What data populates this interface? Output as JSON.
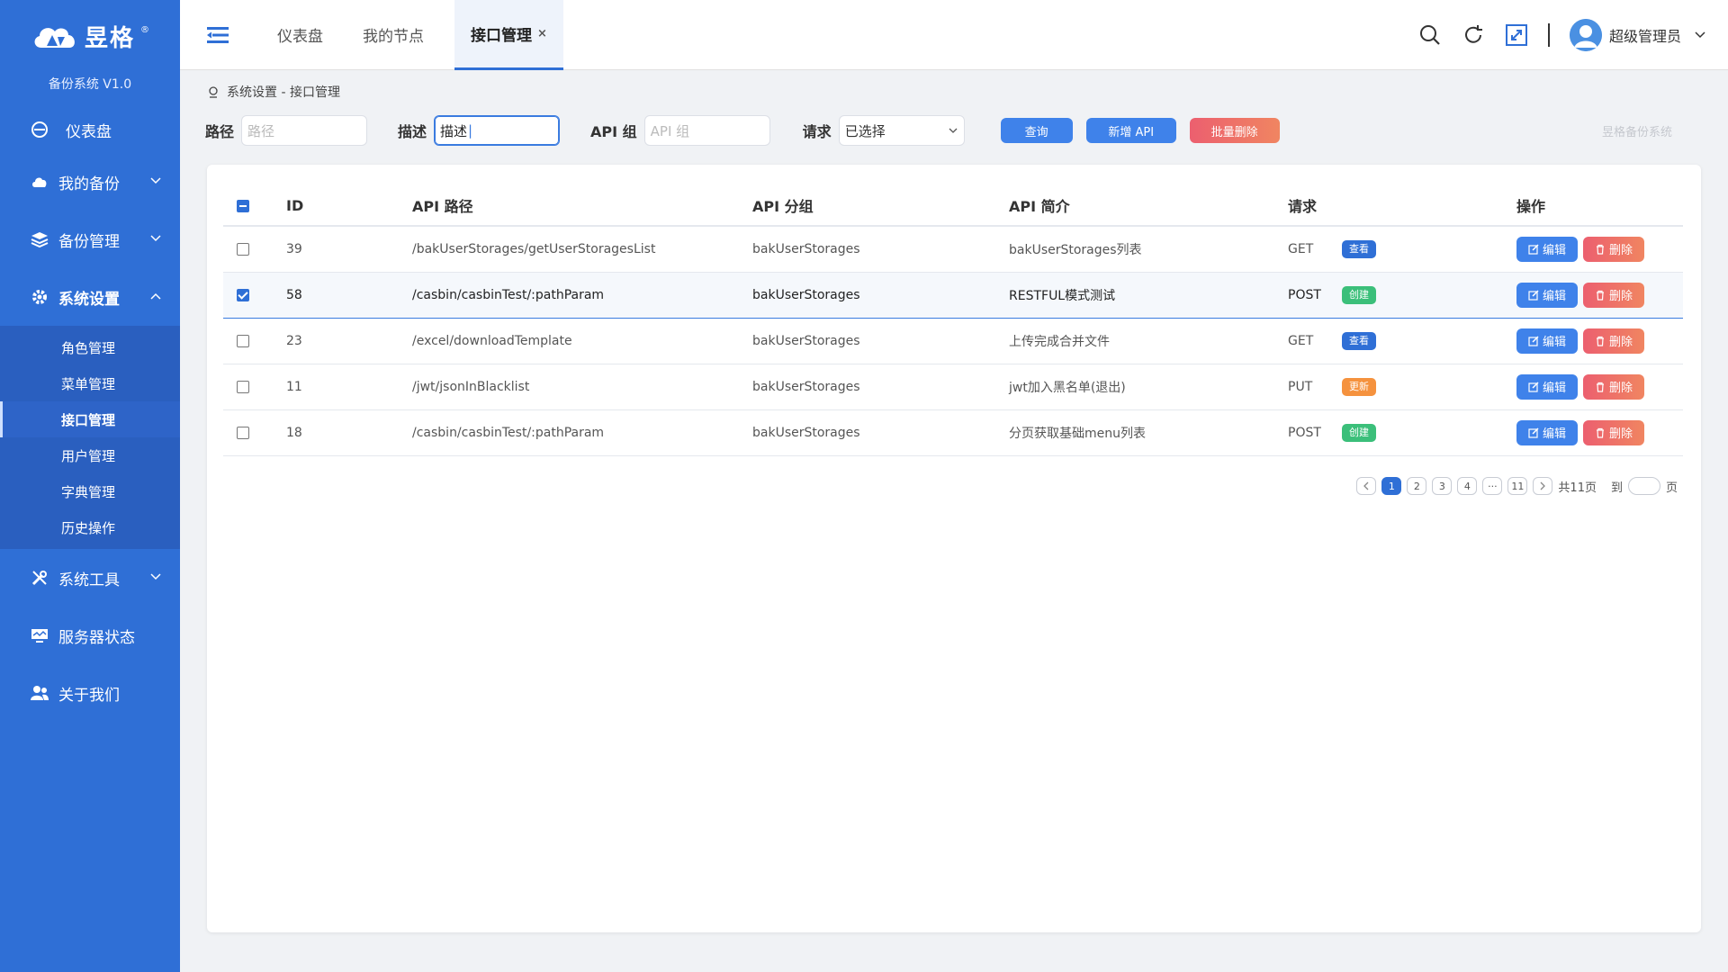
{
  "colors": {
    "sidebar": "#2f6fd6",
    "primary": "#3f82ea",
    "danger": "#ec5f6f",
    "get_badge": "#2f6fd6",
    "post_badge": "#3bbf7a",
    "put_badge": "#f5923e"
  },
  "sidebar": {
    "brand": "昱格",
    "version": "备份系统 V1.0",
    "items": [
      {
        "label": "仪表盘",
        "icon": "dashboard-icon"
      },
      {
        "label": "我的备份",
        "icon": "cloud-icon"
      },
      {
        "label": "备份管理",
        "icon": "layers-icon"
      },
      {
        "label": "系统设置",
        "icon": "gear-icon"
      },
      {
        "label": "系统工具",
        "icon": "tools-icon"
      },
      {
        "label": "服务器状态",
        "icon": "monitor-icon"
      },
      {
        "label": "关于我们",
        "icon": "users-icon"
      }
    ],
    "submenu": [
      "角色管理",
      "菜单管理",
      "接口管理",
      "用户管理",
      "字典管理",
      "历史操作"
    ]
  },
  "tabs": [
    {
      "label": "仪表盘"
    },
    {
      "label": "我的节点"
    },
    {
      "label": "接口管理",
      "close": "×"
    }
  ],
  "header": {
    "user_name": "超级管理员"
  },
  "breadcrumb": "系统设置 - 接口管理",
  "filter": {
    "path_label": "路径",
    "path_placeholder": "路径",
    "desc_label": "描述",
    "desc_value": "描述",
    "group_label": "API 组",
    "group_placeholder": "API 组",
    "method_label": "请求",
    "method_value": "已选择",
    "query_button": "查询",
    "add_button": "新增 API",
    "batch_delete_button": "批量删除",
    "brand_note": "昱格备份系统"
  },
  "table": {
    "headers": [
      "ID",
      "API 路径",
      "API 分组",
      "API 简介",
      "请求",
      "操作"
    ],
    "rows": [
      {
        "id": "39",
        "path": "/bakUserStorages/getUserStoragesList",
        "group": "bakUserStorages",
        "desc": "bakUserStorages列表",
        "method": "GET",
        "badge": "查看",
        "checked": false
      },
      {
        "id": "58",
        "path": "/casbin/casbinTest/:pathParam",
        "group": "bakUserStorages",
        "desc": "RESTFUL模式测试",
        "method": "POST",
        "badge": "创建",
        "checked": true
      },
      {
        "id": "23",
        "path": "/excel/downloadTemplate",
        "group": "bakUserStorages",
        "desc": "上传完成合并文件",
        "method": "GET",
        "badge": "查看",
        "checked": false
      },
      {
        "id": "11",
        "path": "/jwt/jsonInBlacklist",
        "group": "bakUserStorages",
        "desc": "jwt加入黑名单(退出)",
        "method": "PUT",
        "badge": "更新",
        "checked": false
      },
      {
        "id": "18",
        "path": "/casbin/casbinTest/:pathParam",
        "group": "bakUserStorages",
        "desc": "分页获取基础menu列表",
        "method": "POST",
        "badge": "创建",
        "checked": false
      }
    ],
    "edit_label": "编辑",
    "delete_label": "删除"
  },
  "pagination": {
    "pages": [
      "1",
      "2",
      "3",
      "4",
      "···",
      "11"
    ],
    "current": "1",
    "total": "共11页",
    "goto_label": "到",
    "page_suffix": "页"
  }
}
